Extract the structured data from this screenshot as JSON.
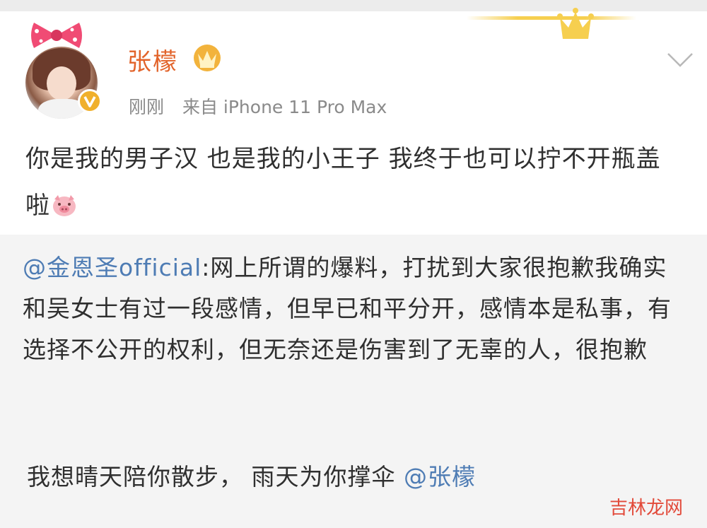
{
  "post": {
    "username": "张檬",
    "time": "刚刚",
    "source": "来自 iPhone 11 Pro Max",
    "text": "你是我的男子汉  也是我的小王子  我终于也可以拧不开瓶盖啦",
    "emoji": "pig-emoji"
  },
  "repost": {
    "mention": "@金恩圣official",
    "text": ":网上所谓的爆料，打扰到大家很抱歉我确实和吴女士有过一段感情，但早已和平分开，感情本是私事，有选择不公开的权利，但无奈还是伤害到了无辜的人，很抱歉"
  },
  "footer": {
    "text": "我想晴天陪你散步， 雨天为你撑伞 ",
    "mention": "@张檬"
  },
  "watermark": "吉林龙网",
  "colors": {
    "username": "#e2632a",
    "mention": "#4e7cb4",
    "repost_bg": "#f4f4f4",
    "watermark": "#e24a3a",
    "vip_badge": "#f0b02c"
  },
  "icons": [
    "crown-icon",
    "verified-badge-icon",
    "chevron-down-icon",
    "pig-emoji"
  ]
}
